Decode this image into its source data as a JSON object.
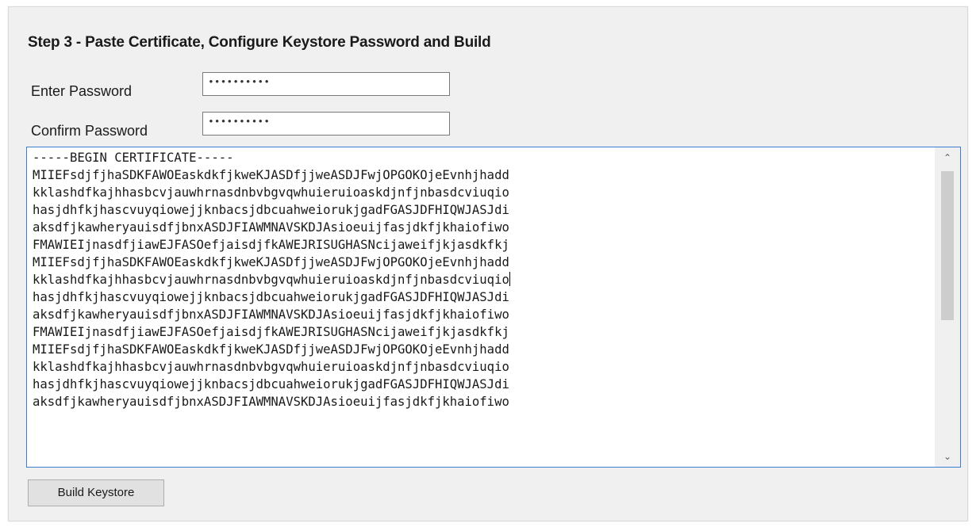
{
  "heading": "Step 3 - Paste Certificate, Configure Keystore Password and Build",
  "enter_password": {
    "label": "Enter Password",
    "value": "••••••••••"
  },
  "confirm_password": {
    "label": "Confirm Password",
    "value": "••••••••••"
  },
  "certificate": {
    "lines": [
      "-----BEGIN CERTIFICATE-----",
      "MIIEFsdjfjhaSDKFAWOEaskdkfjkweKJASDfjjweASDJFwjOPGOKOjeEvnhjhadd",
      "kklashdfkajhhasbcvjauwhrnasdnbvbgvqwhuieruioaskdjnfjnbasdcviuqio",
      "hasjdhfkjhascvuyqiowejjknbacsjdbcuahweiorukjgadFGASJDFHIQWJASJdi",
      "aksdfjkawheryauisdfjbnxASDJFIAWMNAVSKDJAsioeuijfasjdkfjkhaiofiwo",
      "FMAWIEIjnasdfjiawEJFASOefjaisdjfkAWEJRISUGHASNcijaweifjkjasdkfkj",
      "MIIEFsdjfjhaSDKFAWOEaskdkfjkweKJASDfjjweASDJFwjOPGOKOjeEvnhjhadd",
      "kklashdfkajhhasbcvjauwhrnasdnbvbgvqwhuieruioaskdjnfjnbasdcviuqio",
      "hasjdhfkjhascvuyqiowejjknbacsjdbcuahweiorukjgadFGASJDFHIQWJASJdi",
      "aksdfjkawheryauisdfjbnxASDJFIAWMNAVSKDJAsioeuijfasjdkfjkhaiofiwo",
      "FMAWIEIjnasdfjiawEJFASOefjaisdjfkAWEJRISUGHASNcijaweifjkjasdkfkj",
      "MIIEFsdjfjhaSDKFAWOEaskdkfjkweKJASDfjjweASDJFwjOPGOKOjeEvnhjhadd",
      "kklashdfkajhhasbcvjauwhrnasdnbvbgvqwhuieruioaskdjnfjnbasdcviuqio",
      "hasjdhfkjhascvuyqiowejjknbacsjdbcuahweiorukjgadFGASJDFHIQWJASJdi",
      "aksdfjkawheryauisdfjbnxASDJFIAWMNAVSKDJAsioeuijfasjdkfjkhaiofiwo"
    ]
  },
  "scroll": {
    "up_icon": "chevron-up-icon",
    "down_icon": "chevron-down-icon",
    "up_glyph": "⌃",
    "down_glyph": "⌄"
  },
  "build_button": {
    "label": "Build Keystore"
  },
  "colors": {
    "panel_bg": "#f0f0f0",
    "focus_border": "#3c7fd0",
    "button_bg": "#e1e1e1"
  }
}
